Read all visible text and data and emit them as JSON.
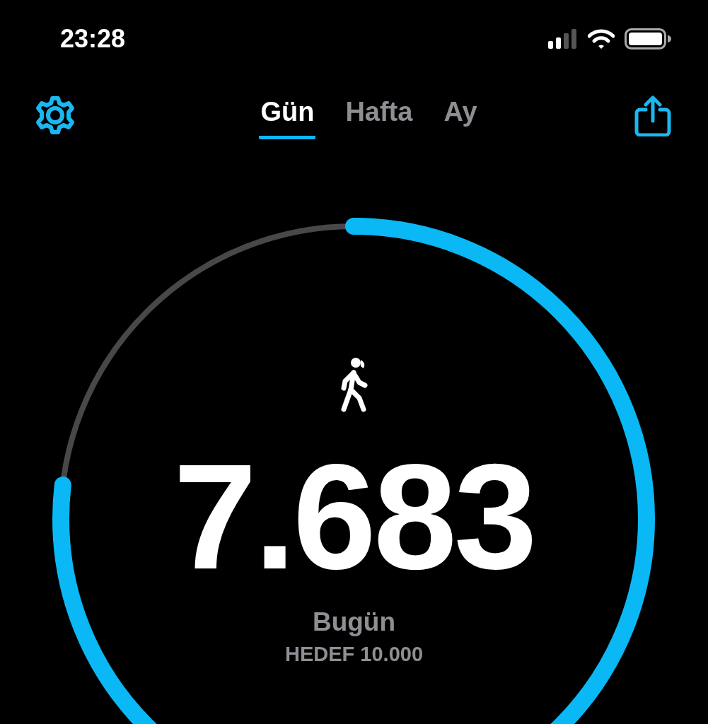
{
  "status_bar": {
    "time": "23:28"
  },
  "tabs": [
    {
      "label": "Gün",
      "selected": true
    },
    {
      "label": "Hafta",
      "selected": false
    },
    {
      "label": "Ay",
      "selected": false
    }
  ],
  "steps": {
    "value": "7.683",
    "label": "Bugün",
    "goal": "HEDEF 10.000"
  }
}
